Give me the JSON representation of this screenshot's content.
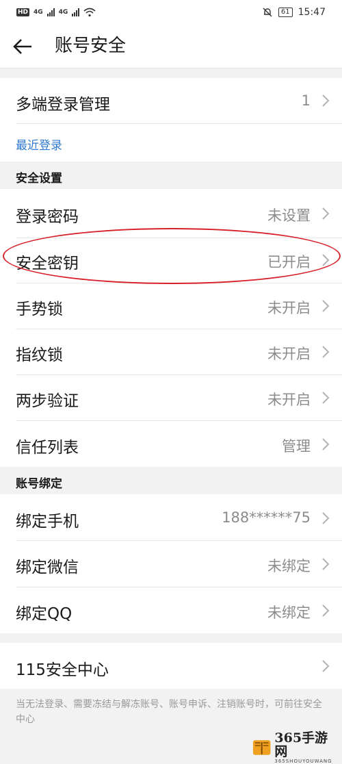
{
  "status_bar": {
    "network_chip": "HD",
    "signal1": "4G",
    "signal2": "4G",
    "battery": "61",
    "time": "15:47"
  },
  "header": {
    "title": "账号安全"
  },
  "multi_login": {
    "label": "多端登录管理",
    "value": "1"
  },
  "recent_login": {
    "label": "最近登录"
  },
  "security_section": {
    "title": "安全设置",
    "items": [
      {
        "label": "登录密码",
        "value": "未设置"
      },
      {
        "label": "安全密钥",
        "value": "已开启"
      },
      {
        "label": "手势锁",
        "value": "未开启"
      },
      {
        "label": "指纹锁",
        "value": "未开启"
      },
      {
        "label": "两步验证",
        "value": "未开启"
      },
      {
        "label": "信任列表",
        "value": "管理"
      }
    ]
  },
  "binding_section": {
    "title": "账号绑定",
    "items": [
      {
        "label": "绑定手机",
        "value": "188******75"
      },
      {
        "label": "绑定微信",
        "value": "未绑定"
      },
      {
        "label": "绑定QQ",
        "value": "未绑定"
      }
    ]
  },
  "security_center": {
    "label": "115安全中心"
  },
  "footer": {
    "note": "当无法登录、需要冻结与解冻账号、账号申诉、注销账号时，可前往安全中心"
  },
  "watermark": {
    "text": "365手游网",
    "sub": "365SHOUYOUWANG"
  },
  "colors": {
    "link": "#2f79d0",
    "annotation": "#d8202a",
    "value_text": "#8c8c8c"
  }
}
